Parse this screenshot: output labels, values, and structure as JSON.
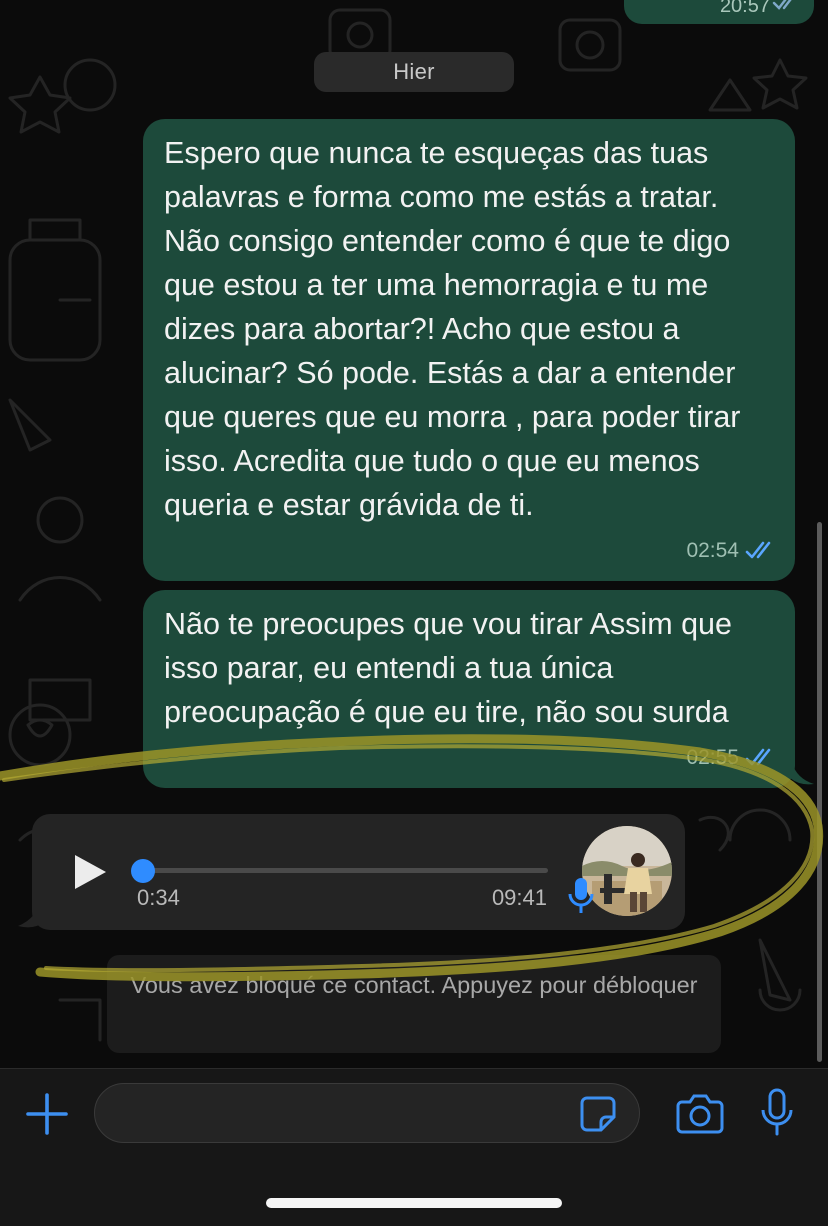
{
  "chat": {
    "top_message": {
      "time": "20:57"
    },
    "day_separator": "Hier",
    "messages": [
      {
        "text": "Espero que nunca te esqueças das tuas palavras e forma como me estás a tratar. Não consigo entender como é que te digo que estou a ter uma hemorragia e tu me dizes para abortar?! Acho que estou a alucinar? Só pode. Estás a dar a entender que queres que eu morra , para poder tirar isso. Acredita que tudo o que eu menos queria e estar grávida de ti.",
        "time": "02:54"
      },
      {
        "text": "Não te preocupes que vou tirar Assim que isso parar, eu entendi a tua única preocupação é que eu tire, não sou surda",
        "time": "02:55"
      }
    ],
    "voice_message": {
      "elapsed": "0:34",
      "time": "09:41",
      "progress": 0.0
    },
    "blocked_notice": "Vous avez bloqué ce contact. Appuyez pour débloquer"
  },
  "composer": {
    "input_value": "",
    "icons": [
      "plus-icon",
      "sticker-icon",
      "camera-icon",
      "microphone-icon"
    ]
  },
  "colors": {
    "outgoing_bubble": "#1d4a3b",
    "incoming_bubble": "#242424",
    "accent": "#2f8cff",
    "read_ticks": "#5aa6ff",
    "highlight_marker": "#a39a2a"
  }
}
